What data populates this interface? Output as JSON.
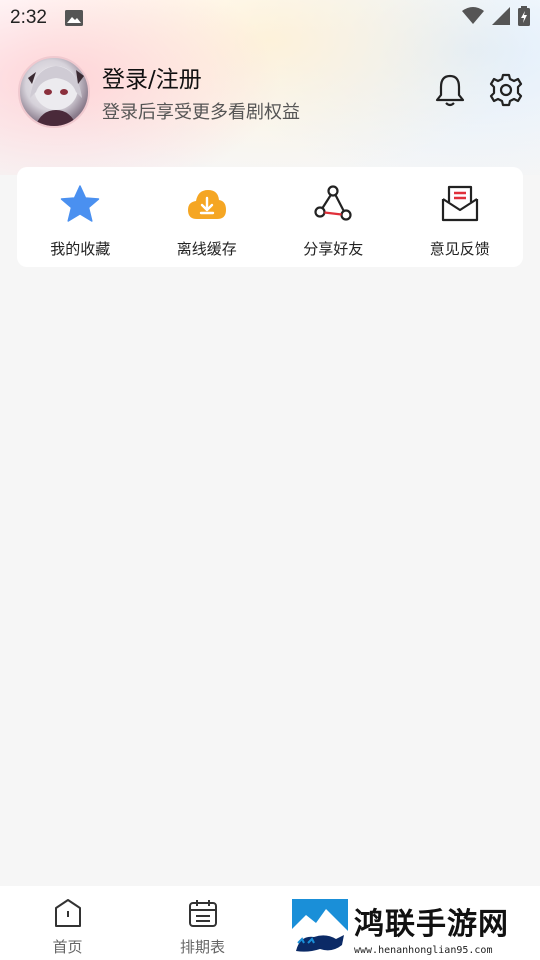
{
  "status_bar": {
    "time": "2:32"
  },
  "profile": {
    "title": "登录/注册",
    "subtitle": "登录后享受更多看剧权益"
  },
  "quick_actions": [
    {
      "label": "我的收藏",
      "icon": "star-icon",
      "color": "#4a90f0"
    },
    {
      "label": "离线缓存",
      "icon": "cloud-download-icon",
      "color": "#f5a623"
    },
    {
      "label": "分享好友",
      "icon": "share-icon",
      "color": "#222222"
    },
    {
      "label": "意见反馈",
      "icon": "mail-feedback-icon",
      "color": "#222222"
    }
  ],
  "bottom_nav": [
    {
      "label": "首页",
      "icon": "home-icon"
    },
    {
      "label": "排期表",
      "icon": "calendar-icon"
    }
  ],
  "watermark": {
    "title": "鸿联手游网",
    "url": "www.henanhonglian95.com"
  },
  "colors": {
    "accent_red": "#e0303a",
    "background": "#f6f6f6"
  }
}
